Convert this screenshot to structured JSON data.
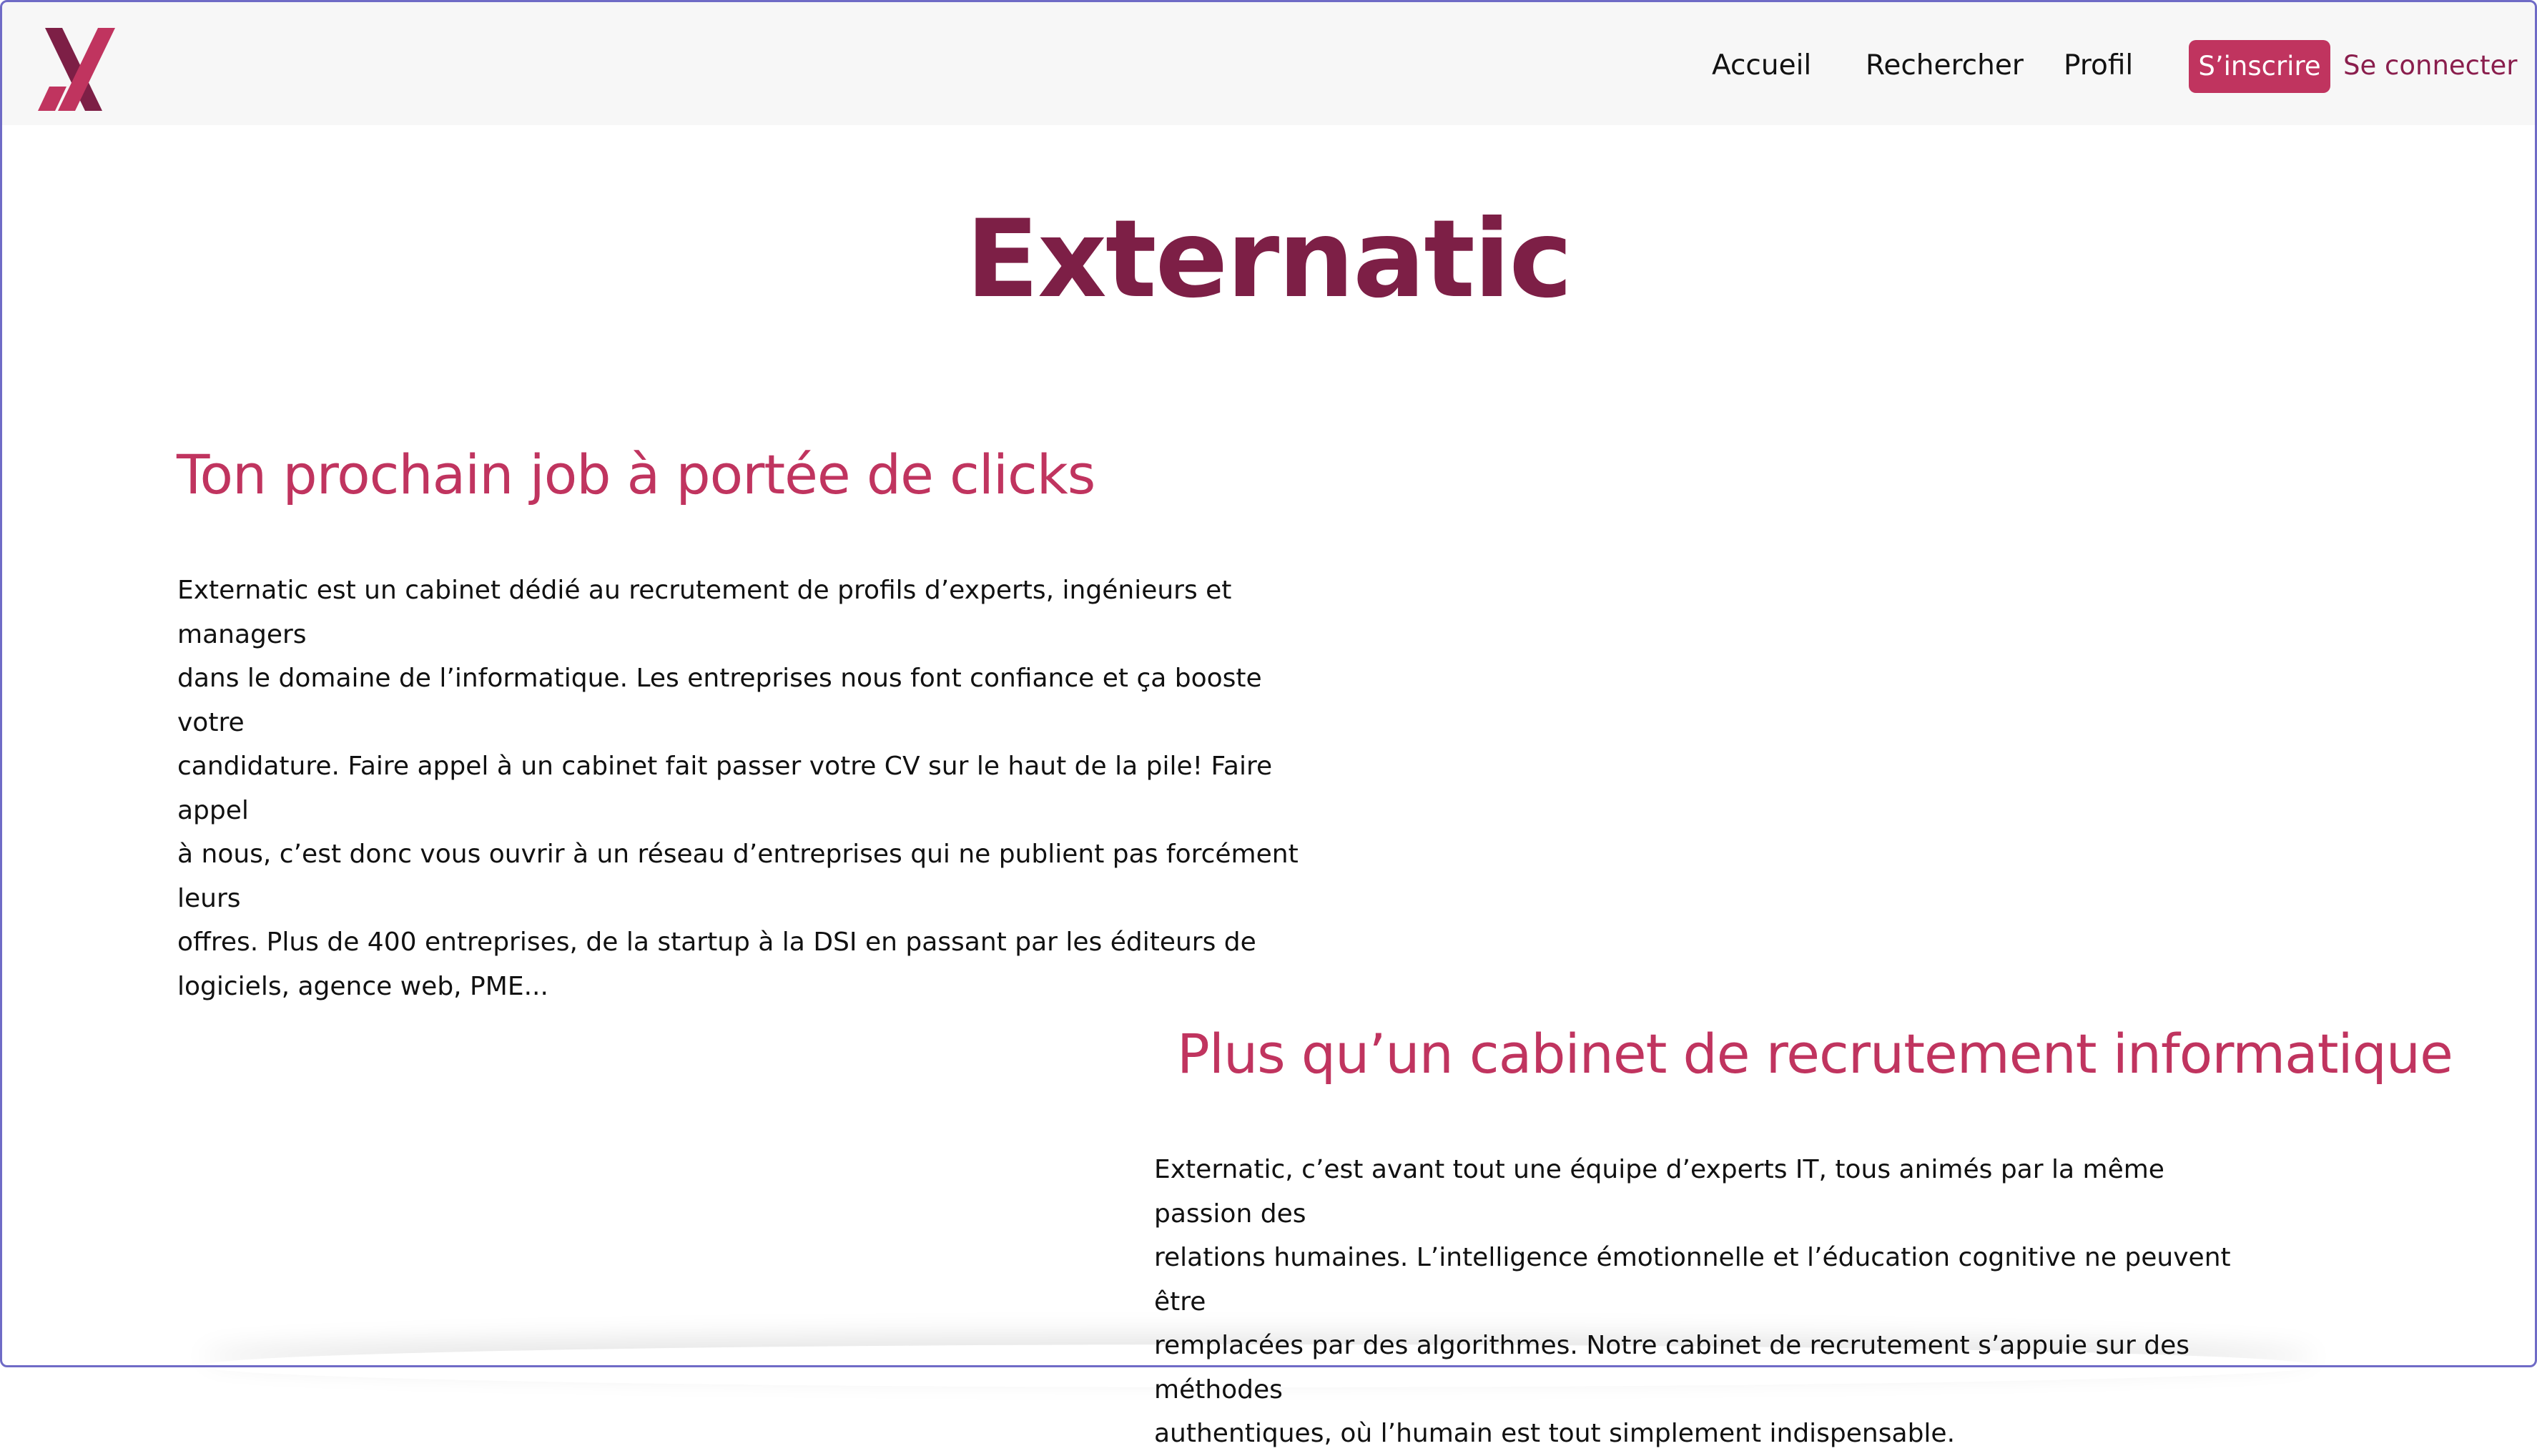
{
  "nav": {
    "links": [
      "Accueil",
      "Rechercher",
      "Profil"
    ],
    "signup_label": "S’inscrire",
    "login_label": "Se connecter"
  },
  "main": {
    "title": "Externatic",
    "section1": {
      "heading": "Ton prochain job à portée de clicks",
      "lines": [
        "Externatic est un cabinet dédié au recrutement de profils d’experts, ingénieurs et managers",
        "dans le domaine de l’informatique. Les entreprises nous font confiance et ça booste votre",
        "candidature. Faire appel à un cabinet fait passer votre CV sur le haut de la pile! Faire appel",
        "à nous, c’est donc vous ouvrir à un réseau d’entreprises qui ne publient pas forcément leurs",
        "offres. Plus de 400 entreprises, de la startup à la DSI en passant par les éditeurs de",
        "logiciels, agence web, PME..."
      ]
    },
    "section2": {
      "heading": "Plus qu’un cabinet de recrutement informatique",
      "lines": [
        "Externatic, c’est avant tout une équipe d’experts IT, tous animés par la même passion des",
        "relations humaines. L’intelligence émotionnelle et l’éducation cognitive ne peuvent être",
        "remplacées par des algorithmes. Notre cabinet de recrutement s’appuie sur des méthodes",
        "authentiques, où l’humain est tout simplement indispensable."
      ]
    }
  },
  "colors": {
    "brand_dark": "#7d1f46",
    "brand_accent": "#c0345f",
    "navbar_bg": "#f7f7f7"
  },
  "icons": {
    "logo": "externatic-x-logo"
  }
}
